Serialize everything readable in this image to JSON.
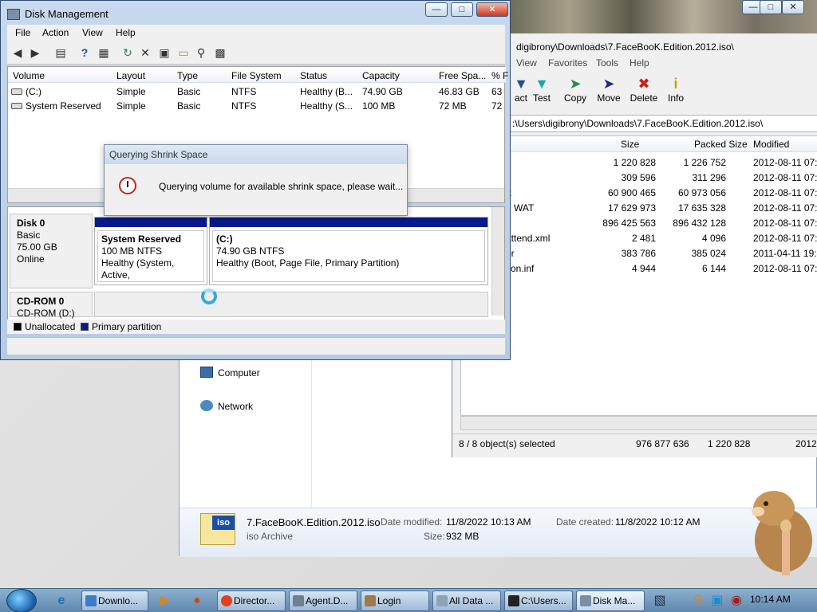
{
  "disk_management": {
    "title": "Disk Management",
    "menu": [
      "File",
      "Action",
      "View",
      "Help"
    ],
    "columns": [
      "Volume",
      "Layout",
      "Type",
      "File System",
      "Status",
      "Capacity",
      "Free Spa...",
      "% F"
    ],
    "volumes": [
      {
        "name": "(C:)",
        "layout": "Simple",
        "type": "Basic",
        "fs": "NTFS",
        "status": "Healthy (B...",
        "capacity": "74.90 GB",
        "free": "46.83 GB",
        "pct": "63"
      },
      {
        "name": "System Reserved",
        "layout": "Simple",
        "type": "Basic",
        "fs": "NTFS",
        "status": "Healthy (S...",
        "capacity": "100 MB",
        "free": "72 MB",
        "pct": "72"
      }
    ],
    "disk0": {
      "name": "Disk 0",
      "type": "Basic",
      "size": "75.00 GB",
      "state": "Online"
    },
    "partition_reserved": {
      "title": "System Reserved",
      "size": "100 MB NTFS",
      "health": "Healthy (System, Active,"
    },
    "partition_c": {
      "title": "(C:)",
      "size": "74.90 GB NTFS",
      "health": "Healthy (Boot, Page File, Primary Partition)"
    },
    "cdrom": {
      "name": "CD-ROM 0",
      "drive": "CD-ROM (D:)"
    },
    "legend": {
      "unallocated": "Unallocated",
      "primary": "Primary partition"
    },
    "colors": {
      "primary": "#0a1a8c",
      "unallocated": "#000000"
    }
  },
  "query_dialog": {
    "title": "Querying Shrink Space",
    "message": "Querying volume for available shrink space, please wait..."
  },
  "sevenzip": {
    "title": "digibrony\\Downloads\\7.FaceBooK.Edition.2012.iso\\",
    "menu": [
      "View",
      "Favorites",
      "Tools",
      "Help"
    ],
    "tools": [
      "act",
      "Test",
      "Copy",
      "Move",
      "Delete",
      "Info"
    ],
    "path": ":\\Users\\digibrony\\Downloads\\7.FaceBooK.Edition.2012.iso\\",
    "columns": [
      "Size",
      "Packed Size",
      "Modified"
    ],
    "rows": [
      {
        "name": "",
        "size": "1 220 828",
        "packed": "1 226 752",
        "modified": "2012-08-11 07:3"
      },
      {
        "name": "",
        "size": "309 596",
        "packed": "311 296",
        "modified": "2012-08-11 07:3"
      },
      {
        "name": "ft",
        "size": "60 900 465",
        "packed": "60 973 056",
        "modified": "2012-08-11 07:3"
      },
      {
        "name": "e WAT",
        "size": "17 629 973",
        "packed": "17 635 328",
        "modified": "2012-08-11 07:3"
      },
      {
        "name": "",
        "size": "896 425 563",
        "packed": "896 432 128",
        "modified": "2012-08-11 07:5"
      },
      {
        "name": "attend.xml",
        "size": "2 481",
        "packed": "4 096",
        "modified": "2012-08-11 07:5"
      },
      {
        "name": "er",
        "size": "383 786",
        "packed": "385 024",
        "modified": "2011-04-11 19:4"
      },
      {
        "name": "tion.inf",
        "size": "4 944",
        "packed": "6 144",
        "modified": "2012-08-11 07:5"
      }
    ],
    "status": {
      "selected": "8 / 8 object(s) selected",
      "total": "976 877 636",
      "packed": "1 220 828",
      "date": "2012-"
    }
  },
  "explorer": {
    "nav": [
      "Computer",
      "Network"
    ],
    "file": {
      "name": "7.FaceBooK.Edition.2012.iso",
      "type": "iso Archive",
      "modified_label": "Date modified:",
      "modified": "11/8/2022 10:13 AM",
      "created_label": "Date created:",
      "created": "11/8/2022 10:12 AM",
      "size_label": "Size:",
      "size": "932 MB",
      "badge": "iso"
    }
  },
  "taskbar": {
    "buttons": [
      "Downlo...",
      "Director...",
      "Agent.D...",
      "Login",
      "All Data ...",
      "C:\\Users...",
      "Disk Ma..."
    ],
    "clock": "10:14 AM"
  }
}
